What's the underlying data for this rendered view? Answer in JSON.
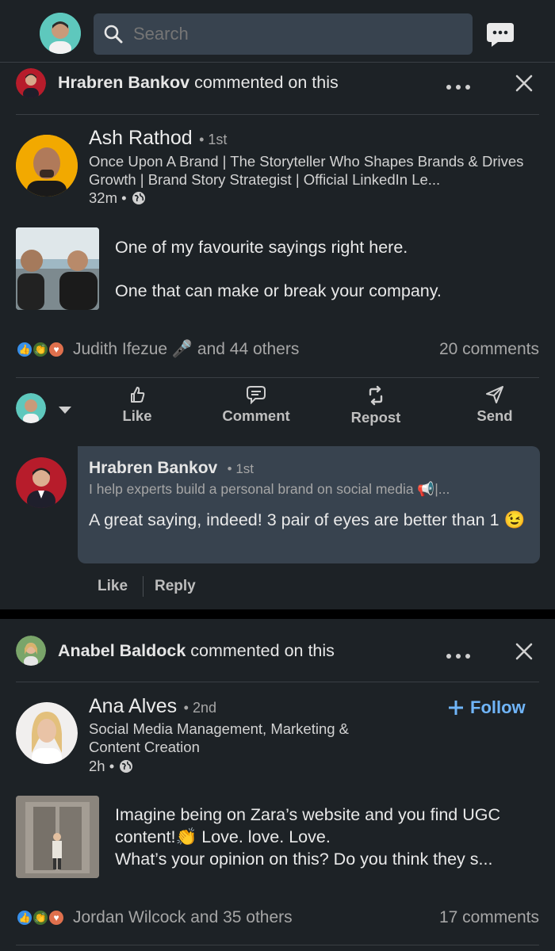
{
  "search": {
    "placeholder": "Search"
  },
  "post1": {
    "actor_name": "Hrabren Bankov",
    "actor_action": " commented on this",
    "author_name": "Ash Rathod",
    "author_degree": "• 1st",
    "author_headline": "Once Upon A Brand | The Storyteller Who Shapes Brands & Drives Growth | Brand Story Strategist | Official LinkedIn Le...",
    "time": "32m •",
    "text_line1": "One of my favourite sayings right here.",
    "text_line2": "One that can make or break your company.",
    "reactions": "Judith Ifezue 🎤 and 44 others",
    "comments": "20 comments"
  },
  "actions": {
    "like": "Like",
    "comment": "Comment",
    "repost": "Repost",
    "send": "Send"
  },
  "comment": {
    "name": "Hrabren Bankov",
    "degree": "• 1st",
    "headline": "I help experts build a personal brand on social media 📢|...",
    "text": "A great saying, indeed! 3 pair of eyes are better than 1 😉",
    "like": "Like",
    "reply": "Reply"
  },
  "post2": {
    "actor_name": "Anabel Baldock",
    "actor_action": " commented on this",
    "author_name": "Ana Alves",
    "author_degree": "• 2nd",
    "follow": "Follow",
    "author_headline": "Social Media Management, Marketing & Content Creation",
    "time": "2h •",
    "text": "Imagine being on Zara’s website and you find UGC content!👏 Love. love. Love.\nWhat’s your opinion on this? Do you think they s...",
    "reactions": "Jordan Wilcock and 35 others",
    "comments": "17 comments"
  },
  "icons": [
    "search-icon",
    "messaging-icon",
    "more-icon",
    "close-icon",
    "globe-icon",
    "like-icon",
    "comment-icon",
    "repost-icon",
    "send-icon",
    "plus-icon",
    "chevron-down-icon"
  ],
  "colors": {
    "background": "#1d2226",
    "accent": "#70b5f9",
    "search_bg": "#38434f",
    "comment_bg": "#38434f"
  }
}
